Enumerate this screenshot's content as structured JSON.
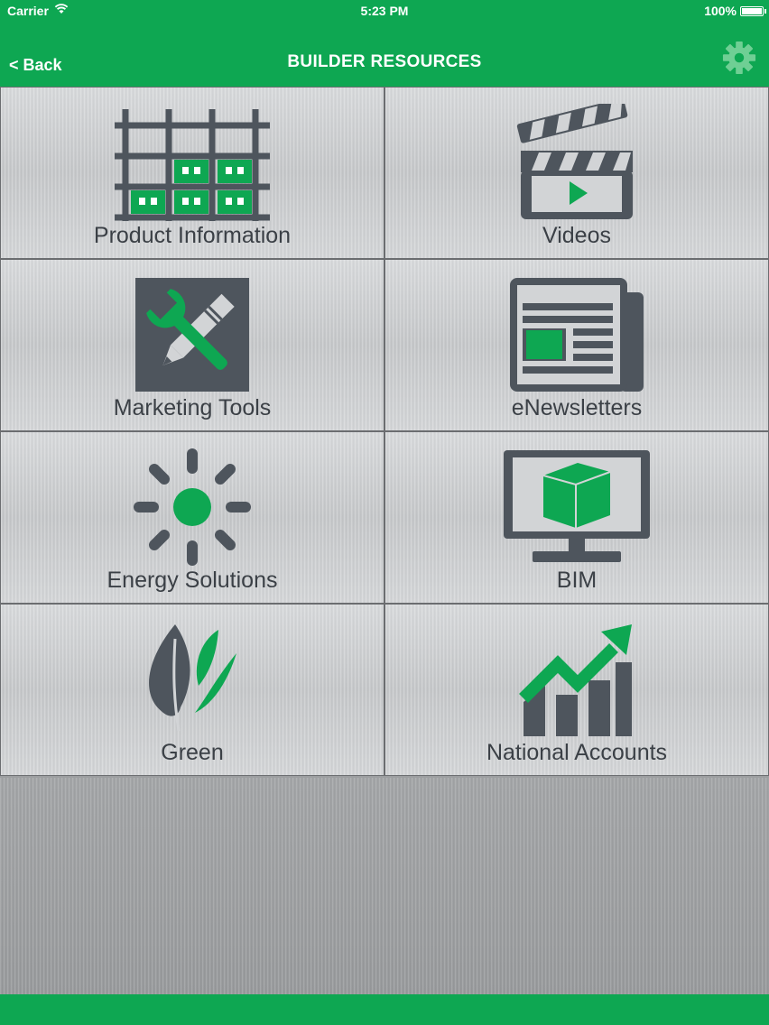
{
  "status_bar": {
    "carrier": "Carrier",
    "time": "5:23 PM",
    "battery": "100%"
  },
  "nav": {
    "back_label": "< Back",
    "title": "BUILDER RESOURCES",
    "settings_icon": "gear-icon"
  },
  "colors": {
    "brand_green": "#0ea752",
    "icon_gray": "#4e555d"
  },
  "tiles": [
    {
      "label": "Product Information",
      "icon": "product-grid-icon"
    },
    {
      "label": "Videos",
      "icon": "clapperboard-icon"
    },
    {
      "label": "Marketing Tools",
      "icon": "wrench-pencil-icon"
    },
    {
      "label": "eNewsletters",
      "icon": "newspaper-icon"
    },
    {
      "label": "Energy Solutions",
      "icon": "sun-icon"
    },
    {
      "label": "BIM",
      "icon": "monitor-cube-icon"
    },
    {
      "label": "Green",
      "icon": "leaf-icon"
    },
    {
      "label": "National Accounts",
      "icon": "growth-chart-icon"
    }
  ]
}
